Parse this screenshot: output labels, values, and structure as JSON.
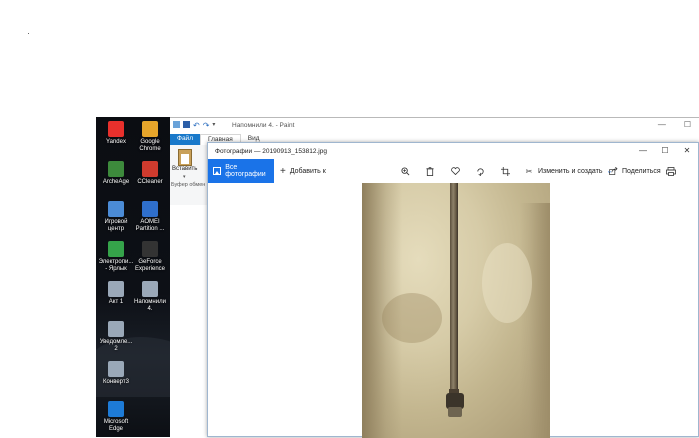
{
  "desktop": {
    "icons": [
      {
        "label": "Yandex",
        "color": "#e8302c"
      },
      {
        "label": "Google Chrome",
        "color": "#e6a52b"
      },
      {
        "label": "ArcheAge",
        "color": "#3d8a3c"
      },
      {
        "label": "CCleaner",
        "color": "#cf3b2e"
      },
      {
        "label": "Игровой центр",
        "color": "#4b8bd6"
      },
      {
        "label": "AOMEI Partition ...",
        "color": "#2f6fcc"
      },
      {
        "label": "Электропи... - Ярлык",
        "color": "#35a34a"
      },
      {
        "label": "GeForce Experience",
        "color": "#333333"
      },
      {
        "label": "Акт 1",
        "color": "#9aa8b8"
      },
      {
        "label": "Напомнили 4.",
        "color": "#9aa8b8"
      },
      {
        "label": "Уведомле... 2",
        "color": "#9aa8b8"
      },
      {
        "label": "",
        "color": "#000000"
      },
      {
        "label": "Конверт3",
        "color": "#9aa8b8"
      },
      {
        "label": "",
        "color": "#000000"
      },
      {
        "label": "Microsoft Edge",
        "color": "#1d7bd7"
      }
    ]
  },
  "paint": {
    "title": "Напомнили 4. - Paint",
    "tabs": [
      "Файл",
      "Главная",
      "Вид"
    ],
    "paste_label": "Вставить",
    "clipboard_group": "Буфер обмен",
    "minimize": "—",
    "maximize": "☐"
  },
  "photos": {
    "title": "Фотографии — 20190913_153812.jpg",
    "window_controls": {
      "minimize": "—",
      "maximize": "☐",
      "close": "✕"
    },
    "toolbar": {
      "all_photos": "Все фотографии",
      "add_to": "Добавить к",
      "edit_create": "Изменить и создать",
      "share": "Поделиться"
    },
    "icons": [
      "zoom-in-icon",
      "delete-icon",
      "favorite-heart-icon",
      "rotate-icon",
      "crop-icon",
      "edit-create-icon",
      "share-icon",
      "print-icon"
    ],
    "accent": "#1a73e8"
  }
}
